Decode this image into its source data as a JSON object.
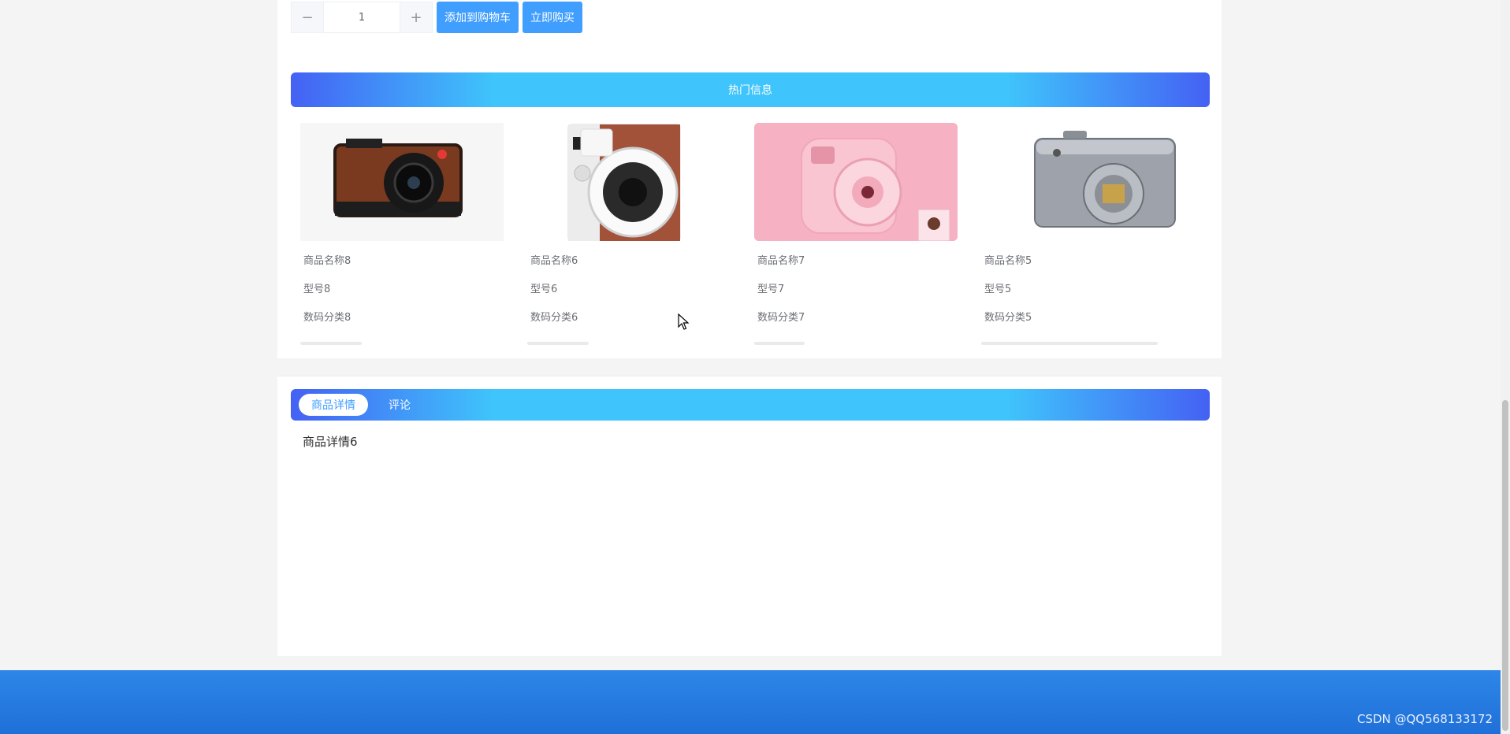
{
  "purchase": {
    "quantity": "1",
    "minus_symbol": "−",
    "plus_symbol": "+",
    "add_to_cart_label": "添加到购物车",
    "buy_now_label": "立即购买"
  },
  "hot": {
    "title": "热门信息",
    "items": [
      {
        "name": "商品名称8",
        "model": "型号8",
        "category": "数码分类8",
        "image": "leather-camera"
      },
      {
        "name": "商品名称6",
        "model": "型号6",
        "category": "数码分类6",
        "image": "instax-camera"
      },
      {
        "name": "商品名称7",
        "model": "型号7",
        "category": "数码分类7",
        "image": "pink-instant-camera"
      },
      {
        "name": "商品名称5",
        "model": "型号5",
        "category": "数码分类5",
        "image": "silver-compact-camera"
      }
    ]
  },
  "detail": {
    "tabs": [
      {
        "label": "商品详情",
        "active": true
      },
      {
        "label": "评论",
        "active": false
      }
    ],
    "content": "商品详情6"
  },
  "footer": {
    "watermark": "CSDN @QQ568133172"
  },
  "colors": {
    "primary": "#409eff",
    "gradient_start": "#4461f4",
    "gradient_mid": "#3fc4fb",
    "footer": "#2479e0"
  }
}
